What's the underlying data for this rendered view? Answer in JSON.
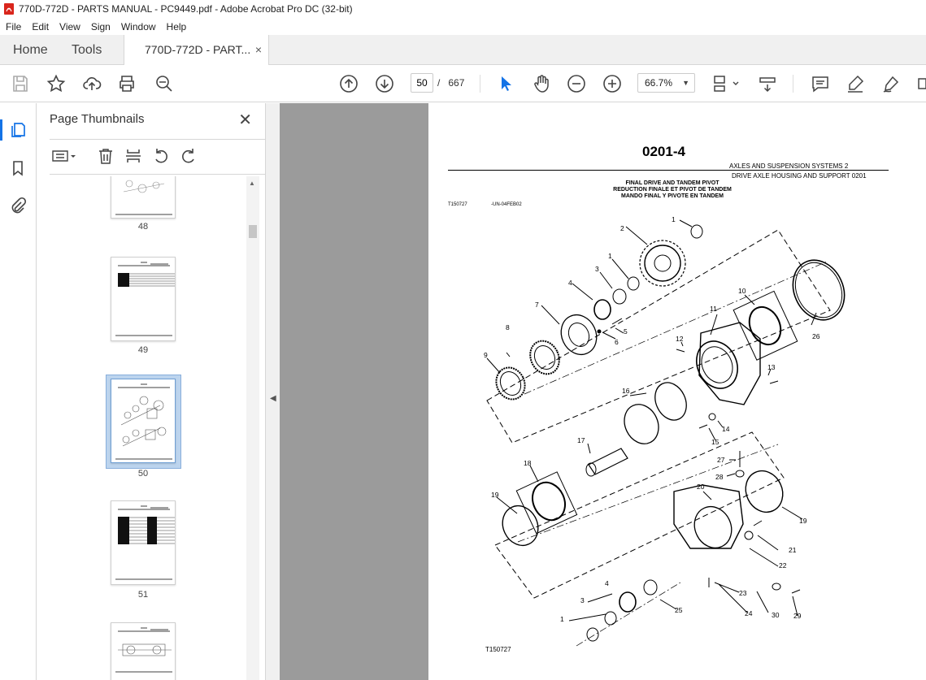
{
  "window": {
    "title": "770D-772D - PARTS MANUAL - PC9449.pdf - Adobe Acrobat Pro DC (32-bit)"
  },
  "menu": [
    "File",
    "Edit",
    "View",
    "Sign",
    "Window",
    "Help"
  ],
  "tabs": {
    "home": "Home",
    "tools": "Tools",
    "document": "770D-772D - PART...",
    "close_glyph": "×"
  },
  "toolbar": {
    "current_page": "50",
    "page_separator": "/",
    "total_pages": "667",
    "zoom": "66.7%"
  },
  "panel": {
    "title": "Page Thumbnails",
    "close_glyph": "✕",
    "thumbnails": [
      {
        "label": "48"
      },
      {
        "label": "49"
      },
      {
        "label": "50",
        "selected": true
      },
      {
        "label": "51"
      }
    ]
  },
  "document": {
    "page_title": "0201-4",
    "header_right_1": "AXLES AND SUSPENSION SYSTEMS    2",
    "header_right_2": "DRIVE AXLE HOUSING AND SUPPORT 0201",
    "caption_1": "FINAL DRIVE AND TANDEM PIVOT",
    "caption_2": "REDUCTION FINALE ET PIVOT DE TANDEM",
    "caption_3": "MANDO FINAL Y PIVOTE EN TANDEM",
    "ref_id": "T150727",
    "ref_date": "-UN-04FEB02",
    "figure_ref": "T150727",
    "callouts": [
      "1",
      "2",
      "1",
      "3",
      "4",
      "5",
      "6",
      "7",
      "8",
      "9",
      "10",
      "11",
      "12",
      "13",
      "14",
      "15",
      "16",
      "17",
      "18",
      "19",
      "20",
      "19",
      "21",
      "22",
      "23",
      "24",
      "25",
      "26",
      "27",
      "28",
      "4",
      "3",
      "1",
      "30",
      "29"
    ]
  },
  "colors": {
    "accent": "#1473e6",
    "canvas": "#9b9b9b",
    "selected_thumb": "#bcd4ee"
  }
}
